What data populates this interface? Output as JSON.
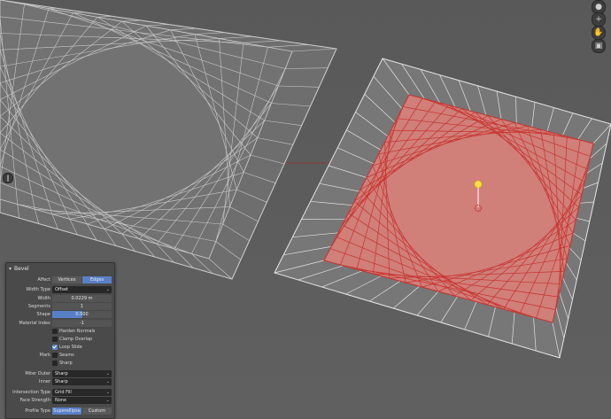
{
  "viewport": {
    "colors": {
      "background": "#5d5d5d",
      "selected_face": "#d8807a",
      "selected_edge": "#c8322e",
      "wire": "#e8e8e8",
      "gizmo": "#ffe040"
    }
  },
  "nav": {
    "top_icon": "gizmo-axis-icon",
    "zoom_icon": "zoom-icon",
    "hand_icon": "pan-hand-icon",
    "camera_icon": "camera-icon"
  },
  "panel": {
    "title": "Bevel",
    "affect": {
      "label": "Affect",
      "options": [
        "Vertices",
        "Edges"
      ],
      "selected": "Edges"
    },
    "width_type": {
      "label": "Width Type",
      "value": "Offset"
    },
    "width": {
      "label": "Width",
      "value": "0.0229 m"
    },
    "segments": {
      "label": "Segments",
      "value": "1"
    },
    "shape": {
      "label": "Shape",
      "value": "0.500",
      "fraction": 0.5
    },
    "material_index": {
      "label": "Material Index",
      "value": "-1"
    },
    "harden_normals": {
      "label": "Harden Normals",
      "checked": false
    },
    "clamp_overlap": {
      "label": "Clamp Overlap",
      "checked": false
    },
    "loop_slide": {
      "label": "Loop Slide",
      "checked": true
    },
    "mark_label": "Mark",
    "seams": {
      "label": "Seams",
      "checked": false
    },
    "sharp": {
      "label": "Sharp",
      "checked": false
    },
    "miter_outer": {
      "label": "Miter Outer",
      "value": "Sharp"
    },
    "inner": {
      "label": "Inner",
      "value": "Sharp"
    },
    "intersection_type": {
      "label": "Intersection Type",
      "value": "Grid Fill"
    },
    "face_strength": {
      "label": "Face Strength",
      "value": "None"
    },
    "profile_type": {
      "label": "Profile Type",
      "options": [
        "Superellipse",
        "Custom"
      ],
      "selected": "Superellipse"
    }
  }
}
